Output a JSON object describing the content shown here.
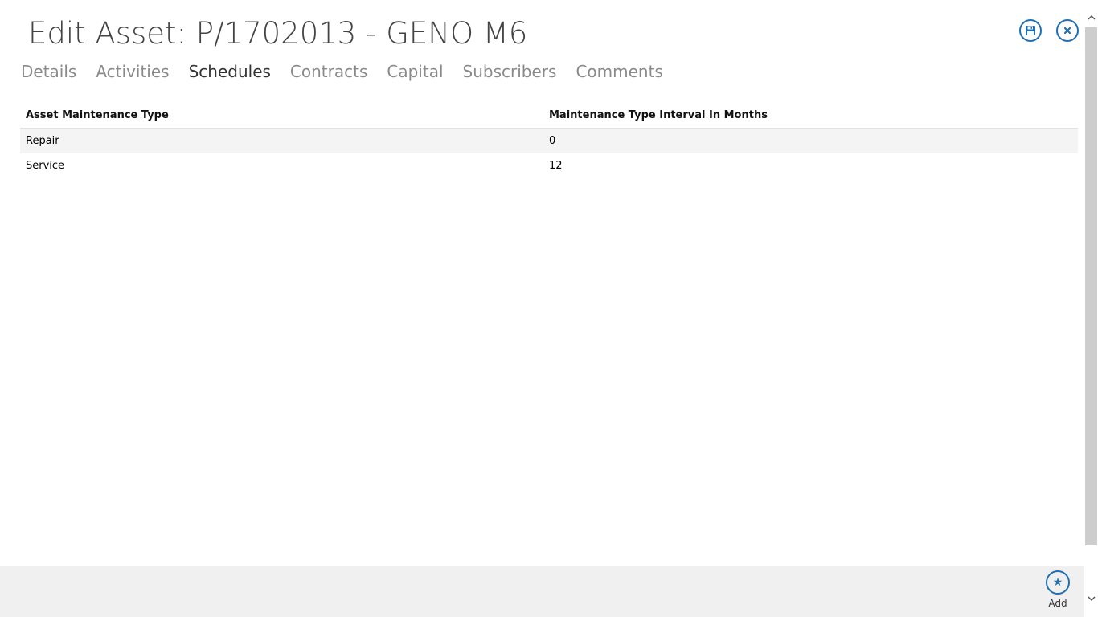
{
  "header": {
    "title": "Edit Asset: P/1702013 - GENO M6",
    "save_icon": "save-icon",
    "close_icon": "close-icon"
  },
  "tabs": [
    {
      "label": "Details",
      "active": false
    },
    {
      "label": "Activities",
      "active": false
    },
    {
      "label": "Schedules",
      "active": true
    },
    {
      "label": "Contracts",
      "active": false
    },
    {
      "label": "Capital",
      "active": false
    },
    {
      "label": "Subscribers",
      "active": false
    },
    {
      "label": "Comments",
      "active": false
    }
  ],
  "grid": {
    "columns": [
      "Asset Maintenance Type",
      "Maintenance Type Interval In Months"
    ],
    "rows": [
      [
        "Repair",
        "0"
      ],
      [
        "Service",
        "12"
      ]
    ]
  },
  "footer": {
    "add_label": "Add",
    "add_icon": "star-icon"
  },
  "colors": {
    "accent": "#1f6fb2",
    "tab_inactive": "#8a8a8a",
    "tab_active": "#333333",
    "footer_bg": "#f0f0f0",
    "row_alt_bg": "#f4f4f4"
  }
}
